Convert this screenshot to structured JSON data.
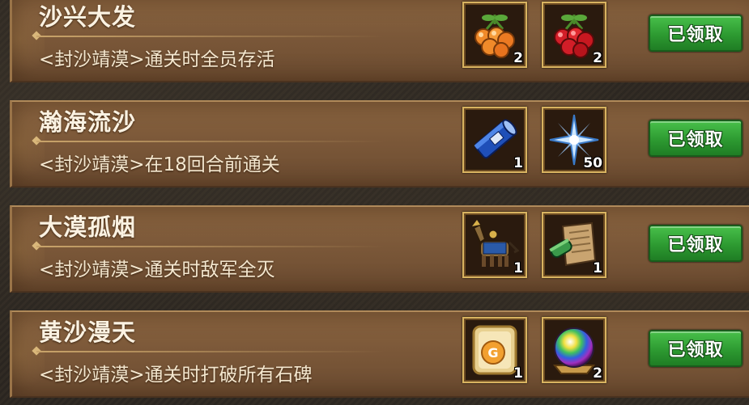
{
  "tasks": [
    {
      "title": "沙兴大发",
      "desc": "<封沙靖漠>通关时全员存活",
      "rewards": [
        {
          "icon": "orange-cherry-icon",
          "count": "2"
        },
        {
          "icon": "red-cherry-icon",
          "count": "2"
        }
      ],
      "button": "已领取"
    },
    {
      "title": "瀚海流沙",
      "desc": "<封沙靖漠>在18回合前通关",
      "rewards": [
        {
          "icon": "blue-scroll-icon",
          "count": "1"
        },
        {
          "icon": "ice-crystal-icon",
          "count": "50"
        }
      ],
      "button": "已领取"
    },
    {
      "title": "大漠孤烟",
      "desc": "<封沙靖漠>通关时敌军全灭",
      "rewards": [
        {
          "icon": "armored-horse-icon",
          "count": "1"
        },
        {
          "icon": "parchment-scroll-icon",
          "count": "1"
        }
      ],
      "button": "已领取"
    },
    {
      "title": "黄沙漫天",
      "desc": "<封沙靖漠>通关时打破所有石碑",
      "rewards": [
        {
          "icon": "gold-token-icon",
          "count": "1"
        },
        {
          "icon": "rainbow-orb-icon",
          "count": "2"
        }
      ],
      "button": "已领取"
    }
  ]
}
